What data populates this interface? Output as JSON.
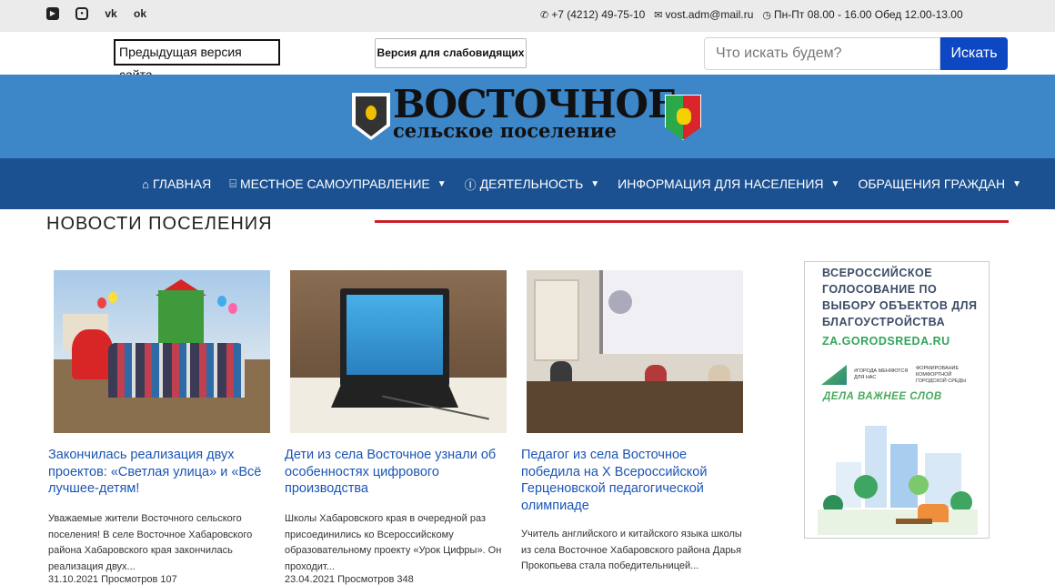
{
  "topbar": {
    "social": [
      "youtube-icon",
      "instagram-icon",
      "vk-icon",
      "odnoklassniki-icon"
    ],
    "phone": "+7 (4212) 49-75-10",
    "email": "vost.adm@mail.ru",
    "hours": "Пн-Пт 08.00 - 16.00 Обед 12.00-13.00"
  },
  "utility": {
    "prev_version": "Предыдущая версия сайта",
    "low_vision": "Версия для слабовидящих",
    "search_placeholder": "Что искать будем?",
    "search_button": "Искать"
  },
  "banner": {
    "line1": "ВОСТОЧНОЕ",
    "line2": "сельское поселение"
  },
  "nav": {
    "items": [
      {
        "label": "ГЛАВНАЯ",
        "icon": "home-icon",
        "dropdown": false
      },
      {
        "label": "МЕСТНОЕ САМОУПРАВЛЕНИЕ",
        "icon": "institution-icon",
        "dropdown": true
      },
      {
        "label": "ДЕЯТЕЛЬНОСТЬ",
        "icon": "info-icon",
        "dropdown": true
      },
      {
        "label": "ИНФОРМАЦИЯ ДЛЯ НАСЕЛЕНИЯ",
        "icon": "",
        "dropdown": true
      },
      {
        "label": "ОБРАЩЕНИЯ ГРАЖДАН",
        "icon": "",
        "dropdown": true
      }
    ]
  },
  "section": {
    "title": "НОВОСТИ ПОСЕЛЕНИЯ"
  },
  "news": [
    {
      "title": "Закончилась реализация двух проектов: «Светлая улица» и «Всё лучшее-детям!",
      "excerpt": "Уважаемые жители Восточного сельского поселения!          В селе Восточное Хабаровского района Хабаровского края закончилась реализация двух...",
      "date": "31.10.2021",
      "views": "Просмотров 107"
    },
    {
      "title": "Дети из села Восточное узнали об особенностях цифрового производства",
      "excerpt": "Школы Хабаровского края в очередной раз присоединились ко Всероссийскому образовательному проекту «Урок Цифры». Он проходит...",
      "date": "23.04.2021",
      "views": "Просмотров 348"
    },
    {
      "title": "Педагог из села Восточное победила на X Всероссийской Герценовской педагогической олимпиаде",
      "excerpt": "Учитель английского и китайского языка школы из села Восточное Хабаровского района Дарья Прокопьева стала победительницей...",
      "date": "",
      "views": ""
    }
  ],
  "ad": {
    "text": "ВСЕРОССИЙСКОЕ ГОЛОСОВАНИЕ ПО ВЫБОРУ ОБЪЕКТОВ ДЛЯ БЛАГОУСТРОЙСТВА",
    "url": "ZA.GORODSREDA.RU",
    "logo1": "#ГОРОДА МЕНЯЮТСЯ ДЛЯ НАС",
    "logo2": "ФОРМИРОВАНИЕ КОМФОРТНОЙ ГОРОДСКОЙ СРЕДЫ",
    "motto": "ДЕЛА ВАЖНЕЕ СЛОВ"
  },
  "colors": {
    "banner": "#3d86c7",
    "nav": "#1b5191",
    "accent_red": "#cc1f2a",
    "link": "#1a55b5",
    "search_button": "#0d47c1"
  }
}
